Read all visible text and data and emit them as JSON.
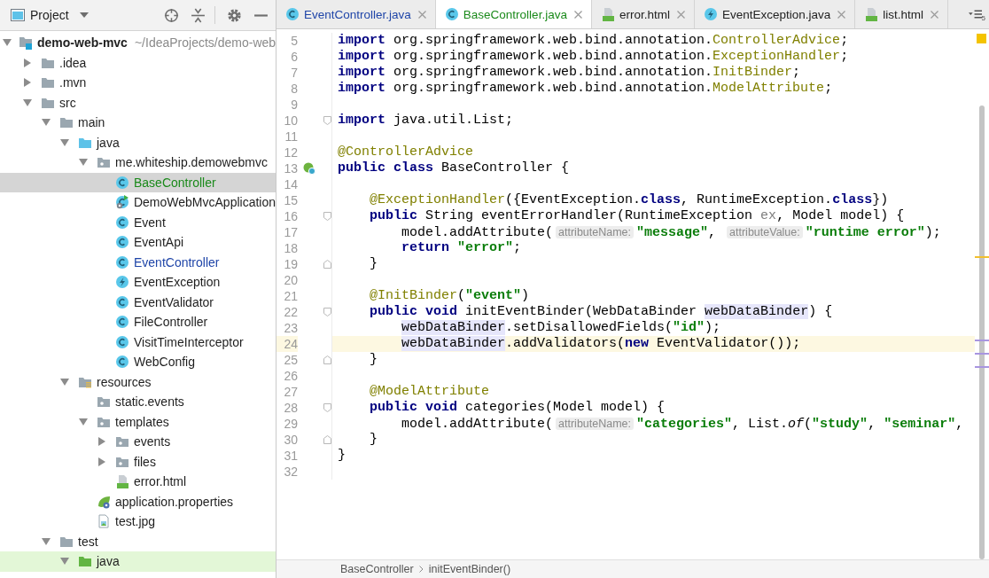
{
  "project_panel": {
    "title": "Project"
  },
  "tree": [
    {
      "label": "demo-web-mvc",
      "path": "~/IdeaProjects/demo-web",
      "kind": "module",
      "expanded": true,
      "selected": false,
      "children": [
        {
          "label": ".idea",
          "kind": "folder",
          "expanded": false,
          "selected": false
        },
        {
          "label": ".mvn",
          "kind": "folder",
          "expanded": false,
          "selected": false
        },
        {
          "label": "src",
          "kind": "folder",
          "expanded": true,
          "selected": false,
          "children": [
            {
              "label": "main",
              "kind": "folder",
              "expanded": true,
              "selected": false,
              "children": [
                {
                  "label": "java",
                  "kind": "source",
                  "expanded": true,
                  "selected": false,
                  "children": [
                    {
                      "label": "me.whiteship.demowebmvc",
                      "kind": "package",
                      "expanded": true,
                      "selected": false,
                      "children": [
                        {
                          "label": "BaseController",
                          "kind": "class",
                          "selected": true,
                          "color": "#1b8a1b"
                        },
                        {
                          "label": "DemoWebMvcApplication",
                          "kind": "application",
                          "selected": false
                        },
                        {
                          "label": "Event",
                          "kind": "class",
                          "selected": false
                        },
                        {
                          "label": "EventApi",
                          "kind": "class",
                          "selected": false
                        },
                        {
                          "label": "EventController",
                          "kind": "class",
                          "selected": false,
                          "color": "#1f45a8"
                        },
                        {
                          "label": "EventException",
                          "kind": "exception",
                          "selected": false
                        },
                        {
                          "label": "EventValidator",
                          "kind": "class",
                          "selected": false
                        },
                        {
                          "label": "FileController",
                          "kind": "class",
                          "selected": false
                        },
                        {
                          "label": "VisitTimeInterceptor",
                          "kind": "class",
                          "selected": false
                        },
                        {
                          "label": "WebConfig",
                          "kind": "class",
                          "selected": false
                        }
                      ]
                    }
                  ]
                },
                {
                  "label": "resources",
                  "kind": "resources",
                  "expanded": true,
                  "selected": false,
                  "children": [
                    {
                      "label": "static.events",
                      "kind": "package",
                      "selected": false
                    },
                    {
                      "label": "templates",
                      "kind": "package",
                      "expanded": true,
                      "selected": false,
                      "children": [
                        {
                          "label": "events",
                          "kind": "package",
                          "expanded": false,
                          "selected": false
                        },
                        {
                          "label": "files",
                          "kind": "package",
                          "expanded": false,
                          "selected": false
                        },
                        {
                          "label": "error.html",
                          "kind": "html",
                          "selected": false
                        }
                      ]
                    },
                    {
                      "label": "application.properties",
                      "kind": "properties",
                      "selected": false
                    },
                    {
                      "label": "test.jpg",
                      "kind": "image",
                      "selected": false
                    }
                  ]
                }
              ]
            },
            {
              "label": "test",
              "kind": "folder",
              "expanded": true,
              "selected": false,
              "children": [
                {
                  "label": "java",
                  "kind": "test",
                  "expanded": true,
                  "selected": false,
                  "highlighted": true
                }
              ]
            }
          ]
        }
      ]
    }
  ],
  "tabs": [
    {
      "label": "EventController.java",
      "kind": "class",
      "selected": false,
      "color": "#1f45a8"
    },
    {
      "label": "BaseController.java",
      "kind": "class",
      "selected": true,
      "color": "#1b8a1b"
    },
    {
      "label": "error.html",
      "kind": "html",
      "selected": false
    },
    {
      "label": "EventException.java",
      "kind": "exception",
      "selected": false
    },
    {
      "label": "list.html",
      "kind": "html",
      "selected": false
    }
  ],
  "tab_overflow": {
    "count": "5"
  },
  "lines": [
    {
      "number": "5",
      "tokens": [
        {
          "kind": "kw",
          "text": "import"
        },
        {
          "kind": "plain",
          "text": " org.springframework.web.bind.annotation."
        },
        {
          "kind": "ann",
          "text": "ControllerAdvice"
        },
        {
          "kind": "plain",
          "text": ";"
        }
      ]
    },
    {
      "number": "6",
      "tokens": [
        {
          "kind": "kw",
          "text": "import"
        },
        {
          "kind": "plain",
          "text": " org.springframework.web.bind.annotation."
        },
        {
          "kind": "ann",
          "text": "ExceptionHandler"
        },
        {
          "kind": "plain",
          "text": ";"
        }
      ]
    },
    {
      "number": "7",
      "tokens": [
        {
          "kind": "kw",
          "text": "import"
        },
        {
          "kind": "plain",
          "text": " org.springframework.web.bind.annotation."
        },
        {
          "kind": "ann",
          "text": "InitBinder"
        },
        {
          "kind": "plain",
          "text": ";"
        }
      ]
    },
    {
      "number": "8",
      "tokens": [
        {
          "kind": "kw",
          "text": "import"
        },
        {
          "kind": "plain",
          "text": " org.springframework.web.bind.annotation."
        },
        {
          "kind": "ann",
          "text": "ModelAttribute"
        },
        {
          "kind": "plain",
          "text": ";"
        }
      ]
    },
    {
      "number": "9"
    },
    {
      "number": "10",
      "kind": "opening",
      "tokens": [
        {
          "kind": "kw",
          "text": "import"
        },
        {
          "kind": "plain",
          "text": " java.util.List;"
        }
      ]
    },
    {
      "number": "11"
    },
    {
      "number": "12",
      "tokens": [
        {
          "kind": "ann",
          "text": "@ControllerAdvice"
        }
      ]
    },
    {
      "number": "13",
      "kind": "bean",
      "tokens": [
        {
          "kind": "kw",
          "text": "public class"
        },
        {
          "kind": "plain",
          "text": " BaseController {"
        }
      ]
    },
    {
      "number": "14"
    },
    {
      "number": "15",
      "tokens": [
        {
          "kind": "ann",
          "text": "    @ExceptionHandler"
        },
        {
          "kind": "plain",
          "text": "({EventException."
        },
        {
          "kind": "kw",
          "text": "class"
        },
        {
          "kind": "plain",
          "text": ", RuntimeException."
        },
        {
          "kind": "kw",
          "text": "class"
        },
        {
          "kind": "plain",
          "text": "})"
        }
      ]
    },
    {
      "number": "16",
      "kind": "opening",
      "tokens": [
        {
          "kind": "kw",
          "text": "    public"
        },
        {
          "kind": "plain",
          "text": " String eventErrorHandler(RuntimeException "
        },
        {
          "kind": "unused",
          "text": "ex"
        },
        {
          "kind": "plain",
          "text": ", Model model) {"
        }
      ]
    },
    {
      "number": "17",
      "tokens": [
        {
          "kind": "plain",
          "text": "        model.addAttribute("
        },
        {
          "kind": "hint",
          "text": "attributeName:"
        },
        {
          "kind": "str",
          "text": "\"message\""
        },
        {
          "kind": "plain",
          "text": ", "
        },
        {
          "kind": "hint",
          "text": "attributeValue:"
        },
        {
          "kind": "str",
          "text": "\"runtime error\""
        },
        {
          "kind": "plain",
          "text": ");"
        }
      ]
    },
    {
      "number": "18",
      "tokens": [
        {
          "kind": "kw",
          "text": "        return "
        },
        {
          "kind": "str",
          "text": "\"error\""
        },
        {
          "kind": "plain",
          "text": ";"
        }
      ]
    },
    {
      "number": "19",
      "kind": "closing",
      "tokens": [
        {
          "kind": "plain",
          "text": "    }"
        }
      ]
    },
    {
      "number": "20"
    },
    {
      "number": "21",
      "tokens": [
        {
          "kind": "ann",
          "text": "    @InitBinder"
        },
        {
          "kind": "plain",
          "text": "("
        },
        {
          "kind": "str",
          "text": "\"event\""
        },
        {
          "kind": "plain",
          "text": ")"
        }
      ]
    },
    {
      "number": "22",
      "kind": "opening",
      "tokens": [
        {
          "kind": "kw",
          "text": "    public void"
        },
        {
          "kind": "plain",
          "text": " initEventBinder(WebDataBinder "
        },
        {
          "kind": "ref",
          "text": "webDataBinder"
        },
        {
          "kind": "plain",
          "text": ") {"
        }
      ]
    },
    {
      "number": "23",
      "tokens": [
        {
          "kind": "ref",
          "text": "        webDataBinder"
        },
        {
          "kind": "plain",
          "text": ".setDisallowedFields("
        },
        {
          "kind": "str",
          "text": "\"id\""
        },
        {
          "kind": "plain",
          "text": ");"
        }
      ]
    },
    {
      "number": "24",
      "current": true,
      "tokens": [
        {
          "kind": "ref",
          "text": "        webDataBinder"
        },
        {
          "kind": "plain",
          "text": ".addValidators("
        },
        {
          "kind": "kw",
          "text": "new"
        },
        {
          "kind": "plain",
          "text": " EventValidator());"
        }
      ]
    },
    {
      "number": "25",
      "kind": "closing",
      "tokens": [
        {
          "kind": "plain",
          "text": "    }"
        }
      ]
    },
    {
      "number": "26"
    },
    {
      "number": "27",
      "tokens": [
        {
          "kind": "ann",
          "text": "    @ModelAttribute"
        }
      ]
    },
    {
      "number": "28",
      "kind": "opening",
      "tokens": [
        {
          "kind": "kw",
          "text": "    public void"
        },
        {
          "kind": "plain",
          "text": " categories(Model model) {"
        }
      ]
    },
    {
      "number": "29",
      "tokens": [
        {
          "kind": "plain",
          "text": "        model.addAttribute("
        },
        {
          "kind": "hint",
          "text": "attributeName:"
        },
        {
          "kind": "str",
          "text": "\"categories\""
        },
        {
          "kind": "plain",
          "text": ", List."
        },
        {
          "kind": "italic",
          "text": "of"
        },
        {
          "kind": "plain",
          "text": "("
        },
        {
          "kind": "str",
          "text": "\"study\""
        },
        {
          "kind": "plain",
          "text": ", "
        },
        {
          "kind": "str",
          "text": "\"seminar\""
        },
        {
          "kind": "plain",
          "text": ","
        }
      ]
    },
    {
      "number": "30",
      "kind": "closing",
      "tokens": [
        {
          "kind": "plain",
          "text": "    }"
        }
      ]
    },
    {
      "number": "31",
      "tokens": [
        {
          "kind": "plain",
          "text": "}"
        }
      ]
    },
    {
      "number": "32"
    }
  ],
  "breadcrumbs": [
    "BaseController",
    "initEventBinder()"
  ]
}
